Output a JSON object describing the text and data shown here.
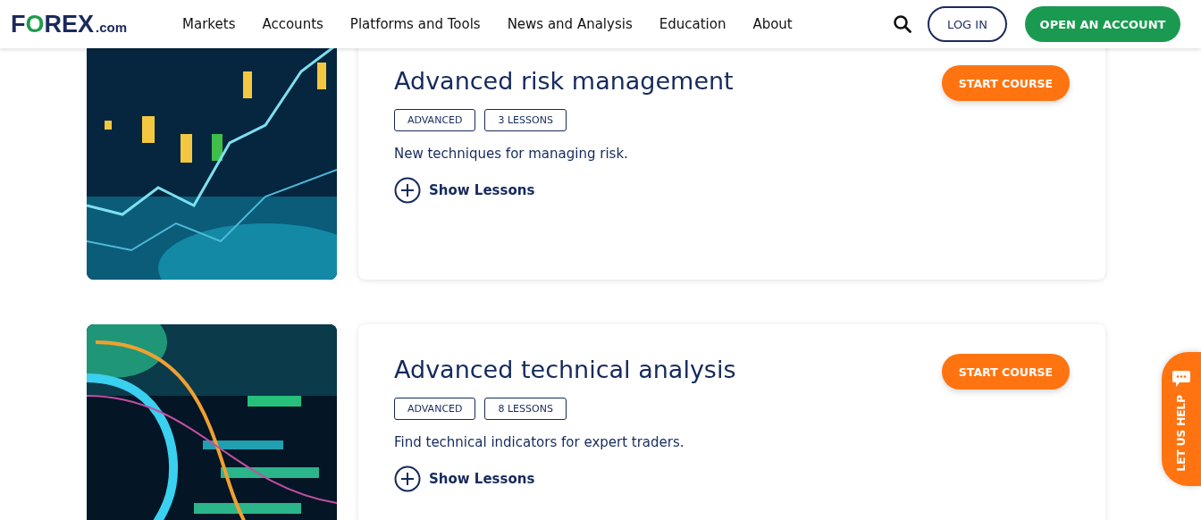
{
  "header": {
    "logo": {
      "text": "FOREX",
      "suffix": ".com"
    },
    "nav": [
      {
        "label": "Markets"
      },
      {
        "label": "Accounts"
      },
      {
        "label": "Platforms and Tools"
      },
      {
        "label": "News and Analysis"
      },
      {
        "label": "Education"
      },
      {
        "label": "About"
      }
    ],
    "login": "LOG IN",
    "open_account": "OPEN AN ACCOUNT"
  },
  "courses": [
    {
      "title": "Advanced risk management",
      "tags": [
        "ADVANCED",
        "3 LESSONS"
      ],
      "description": "New techniques for managing risk.",
      "toggle": "Show Lessons",
      "button": "START COURSE"
    },
    {
      "title": "Advanced technical analysis",
      "tags": [
        "ADVANCED",
        "8 LESSONS"
      ],
      "description": "Find technical indicators for expert traders.",
      "toggle": "Show Lessons",
      "button": "START COURSE"
    }
  ],
  "help_tab": "LET US HELP"
}
